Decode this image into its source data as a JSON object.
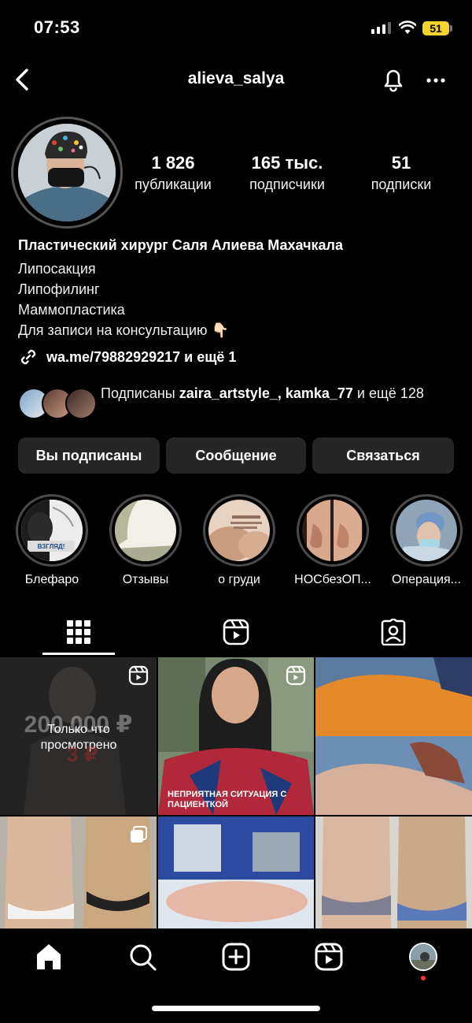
{
  "status": {
    "time": "07:53",
    "battery": "51"
  },
  "header": {
    "username": "alieva_salya"
  },
  "stats": [
    {
      "value": "1 826",
      "label": "публикации"
    },
    {
      "value": "165 тыс.",
      "label": "подписчики"
    },
    {
      "value": "51",
      "label": "подписки"
    }
  ],
  "bio": {
    "name": "Пластический хирург Саля Алиева Махачкала",
    "lines": [
      "Липосакция",
      "Липофилинг",
      "Маммопластика",
      "Для записи на консультацию 👇🏻"
    ],
    "link": "wa.me/79882929217 и ещё 1"
  },
  "followed_by": {
    "prefix": "Подписаны ",
    "users": "zaira_artstyle_, kamka_77",
    "suffix": " и ещё 128"
  },
  "buttons": {
    "following": "Вы подписаны",
    "message": "Сообщение",
    "contact": "Связаться"
  },
  "highlights": [
    {
      "label": "Блефаро",
      "overlay": "ВЗГЛЯД!"
    },
    {
      "label": "Отзывы"
    },
    {
      "label": "о груди"
    },
    {
      "label": "НОСбезОП..."
    },
    {
      "label": "Операция..."
    }
  ],
  "posts": [
    {
      "overlay_top": "200 000 ₽",
      "overlay_mid": "Только что просмотрено",
      "overlay_bot": "3 ₽"
    },
    {
      "caption": "НЕПРИЯТНАЯ СИТУАЦИЯ С ПАЦИЕНТКОЙ"
    }
  ],
  "icons": {
    "back": "chevron-left-icon",
    "bell": "bell-icon",
    "more": "more-icon",
    "link": "link-icon",
    "grid": "grid-icon",
    "reels": "reels-icon",
    "tagged": "tagged-icon",
    "home": "home-icon",
    "search": "search-icon",
    "add": "add-icon",
    "reels_nav": "reels-icon",
    "profile": "profile-avatar"
  }
}
